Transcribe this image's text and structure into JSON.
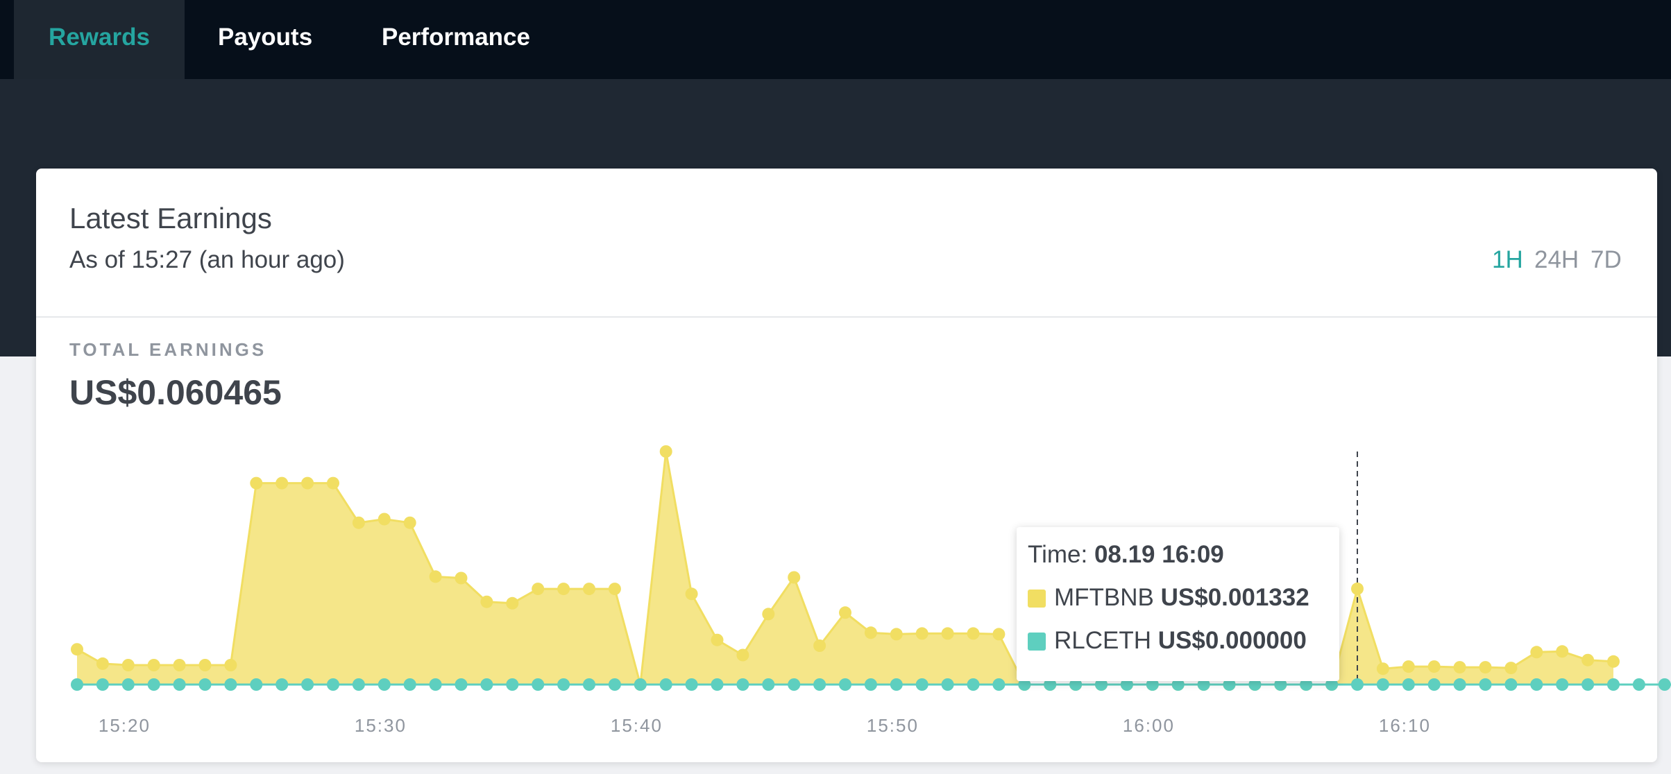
{
  "nav": {
    "tabs": [
      {
        "label": "Rewards",
        "active": true
      },
      {
        "label": "Payouts",
        "active": false
      },
      {
        "label": "Performance",
        "active": false
      }
    ]
  },
  "card": {
    "title": "Latest Earnings",
    "subtitle": "As of 15:27 (an hour ago)",
    "ranges": [
      {
        "label": "1H",
        "active": true
      },
      {
        "label": "24H",
        "active": false
      },
      {
        "label": "7D",
        "active": false
      }
    ],
    "total_label": "TOTAL EARNINGS",
    "total_value": "US$0.060465"
  },
  "tooltip": {
    "time_label": "Time:",
    "time_value": "08.19 16:09",
    "rows": [
      {
        "name": "MFTBNB",
        "value": "US$0.001332",
        "color": "#f1de62"
      },
      {
        "name": "RLCETH",
        "value": "US$0.000000",
        "color": "#5ecfbf"
      }
    ]
  },
  "colors": {
    "accent": "#25a5a0",
    "mftbnb": "#f1de62",
    "rlceth": "#5ecfbf"
  },
  "chart_data": {
    "type": "area",
    "x_ticks": [
      "15:20",
      "15:30",
      "15:40",
      "15:50",
      "16:00",
      "16:10"
    ],
    "x_start": "15:19",
    "x_step_minutes": 1,
    "highlight_x": "16:09",
    "series": [
      {
        "name": "MFTBNB",
        "color": "#f1de62",
        "values": [
          0.00049,
          0.00029,
          0.00027,
          0.00027,
          0.00027,
          0.00027,
          0.00027,
          0.0028,
          0.0028,
          0.0028,
          0.0028,
          0.00225,
          0.0023,
          0.00225,
          0.0015,
          0.00148,
          0.00115,
          0.00113,
          0.00133,
          0.00133,
          0.00133,
          0.00133,
          0.0,
          0.00324,
          0.00126,
          0.00062,
          0.00041,
          0.00098,
          0.00149,
          0.00054,
          0.001,
          0.00072,
          0.0007,
          0.00071,
          0.00071,
          0.00071,
          0.0007,
          0.0,
          0.0,
          0.0,
          0.0,
          0.0,
          0.0,
          0.0,
          0.0,
          0.0,
          0.0,
          0.0,
          0.0,
          0.0,
          0.001332,
          0.00022,
          0.00025,
          0.00025,
          0.00024,
          0.00024,
          0.00023,
          0.00045,
          0.00046,
          0.00034,
          0.00032
        ]
      },
      {
        "name": "RLCETH",
        "color": "#5ecfbf",
        "values": [
          0,
          0,
          0,
          0,
          0,
          0,
          0,
          0,
          0,
          0,
          0,
          0,
          0,
          0,
          0,
          0,
          0,
          0,
          0,
          0,
          0,
          0,
          0,
          0,
          0,
          0,
          0,
          0,
          0,
          0,
          0,
          0,
          0,
          0,
          0,
          0,
          0,
          0,
          0,
          0,
          0,
          0,
          0,
          0,
          0,
          0,
          0,
          0,
          0,
          0,
          0,
          0,
          0,
          0,
          0,
          0,
          0,
          0,
          0,
          0,
          0,
          0,
          0,
          0,
          0
        ]
      }
    ]
  }
}
